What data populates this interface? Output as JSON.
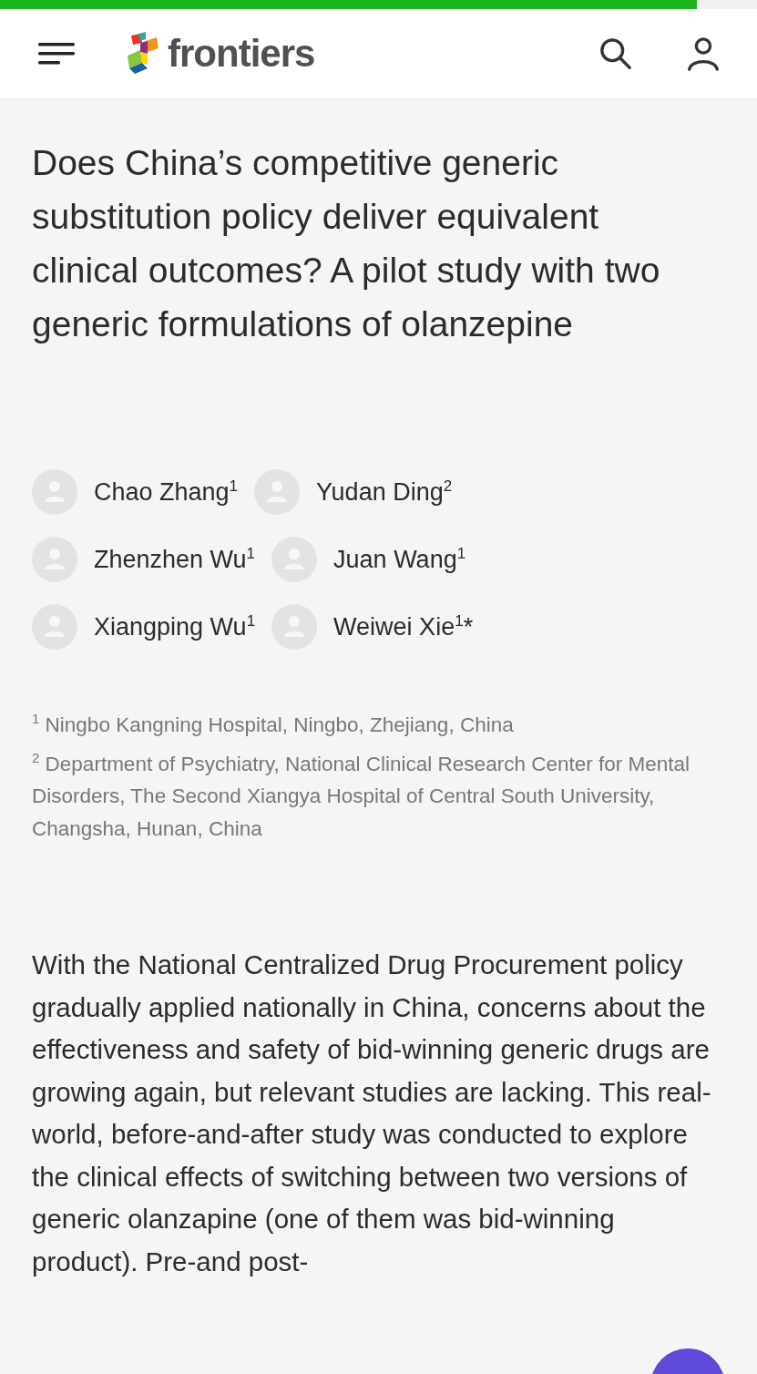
{
  "progress": {
    "level": 0.92
  },
  "header": {
    "logo_text": "frontiers"
  },
  "title": "Does China’s competitive generic substitution policy deliver equivalent clinical outcomes? A pilot study with two generic formulations of olanzepine",
  "author_rows": [
    [
      {
        "name": "Chao Zhang$^{1}$"
      },
      {
        "name": "Yudan Ding$^{2}$"
      }
    ],
    [
      {
        "name": "Zhenzhen Wu$^{1}$"
      },
      {
        "name": "Juan Wang$^{1}$"
      }
    ],
    [
      {
        "name": "Xiangping Wu$^{1}$"
      },
      {
        "name": "Weiwei Xie$^{1}$*"
      }
    ]
  ],
  "affiliations": [
    "$^{1}$ Ningbo Kangning Hospital, Ningbo, Zhejiang, China",
    "$^{2}$ Department of Psychiatry, National Clinical Research Center for Mental Disorders, The Second Xiangya Hospital of Central South University, Changsha, Hunan, China"
  ],
  "abstract": "With the National Centralized Drug Procurement policy gradually applied nationally in China, concerns about the effectiveness and safety of bid-winning generic drugs are growing again, but relevant studies are lacking. This real-world, before-and-after study was conducted to explore the clinical effects of switching between two versions of generic olanzapine (one of them was bid-winning product). Pre-and post-"
}
